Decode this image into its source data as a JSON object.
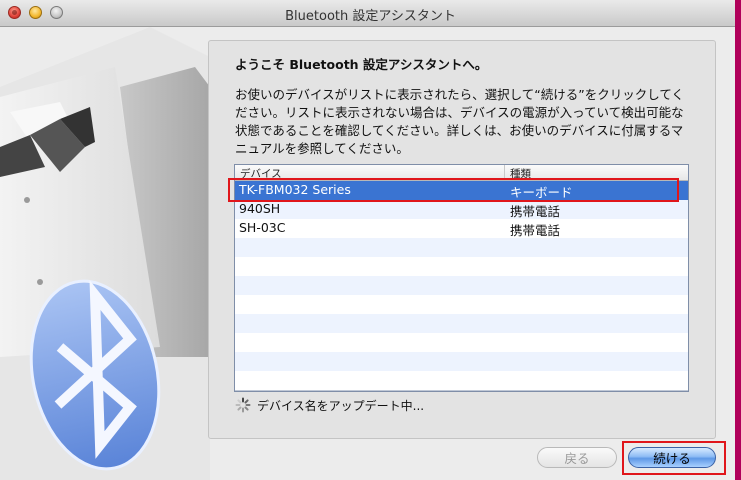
{
  "window": {
    "title": "Bluetooth 設定アシスタント"
  },
  "controls": {
    "close": "close",
    "minimize": "minimize",
    "zoom": "zoom"
  },
  "panel": {
    "heading": "ようこそ Bluetooth 設定アシスタントへ。",
    "description": "お使いのデバイスがリストに表示されたら、選択して“続ける”をクリックしてください。リストに表示されない場合は、デバイスの電源が入っていて検出可能な状態であることを確認してください。詳しくは、お使いのデバイスに付属するマニュアルを参照してください。"
  },
  "device_table": {
    "columns": [
      "デバイス",
      "種類"
    ],
    "rows": [
      {
        "device": "TK-FBM032 Series",
        "type": "キーボード",
        "selected": true
      },
      {
        "device": "940SH",
        "type": "携帯電話",
        "selected": false
      },
      {
        "device": "SH-03C",
        "type": "携帯電話",
        "selected": false
      }
    ],
    "empty_rows": 8
  },
  "status": {
    "text": "デバイス名をアップデート中..."
  },
  "buttons": {
    "back": "戻る",
    "continue": "続ける"
  },
  "colors": {
    "selection": "#3a74d2",
    "highlight_box": "#e0161b",
    "bluetooth_badge": "#7fa3e8"
  }
}
